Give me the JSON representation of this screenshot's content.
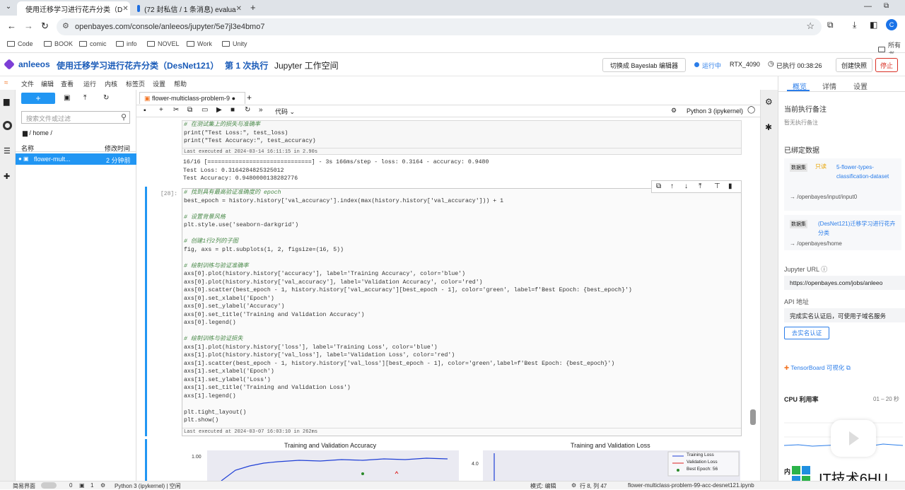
{
  "browser": {
    "tabs": [
      {
        "title": "使用迁移学习进行花卉分类（D"
      },
      {
        "title": "(72 封私信 / 1 条消息) evalua"
      }
    ],
    "url": "openbayes.com/console/anleeos/jupyter/5e7jl3e4bmo7",
    "profile_letter": "C",
    "bookmarks": [
      "Code",
      "BOOK",
      "comic",
      "info",
      "NOVEL",
      "Work",
      "Unity"
    ],
    "bookmarks_right": "所有书"
  },
  "header": {
    "user": "anleeos",
    "title": "使用迁移学习进行花卉分类（DesNet121）",
    "run": "第 1 次执行",
    "workspace": "Jupyter 工作空间",
    "switch_btn": "切换成 Bayeslab 编辑器",
    "status": "运行中",
    "gpu": "RTX_4090",
    "elapsed": "已执行 00:38:26",
    "snapshot_btn": "创建快照",
    "stop_btn": "停止"
  },
  "menu": [
    "文件",
    "编辑",
    "查看",
    "运行",
    "内核",
    "标签页",
    "设置",
    "帮助"
  ],
  "filebrowser": {
    "new_label": "+",
    "search_placeholder": "搜索文件或过滤",
    "path": "/ home /",
    "col_name": "名称",
    "col_modified": "修改时间",
    "files": [
      {
        "name": "flower-mult...",
        "modified": "2 分钟前"
      }
    ]
  },
  "notebook": {
    "tab_title": "flower-multiclass-problem-9",
    "cell_type": "代码",
    "kernel": "Python 3 (ipykernel)",
    "cell1": {
      "lines": [
        [
          "cm",
          "# 在测试集上的损失与准确率"
        ],
        [
          "",
          "print(\"Test Loss:\", test_loss)"
        ],
        [
          "",
          "print(\"Test Accuracy:\", test_accuracy)"
        ]
      ],
      "executed": "Last executed at 2024-03-14 16:11:15 in 2.90s",
      "output": [
        "16/16 [==============================] - 3s 166ms/step - loss: 0.3164 - accuracy: 0.9480",
        "Test Loss: 0.3164284825325012",
        "Test Accuracy: 0.9480000138282776"
      ]
    },
    "cell2": {
      "prompt": "[28]:",
      "lines": [
        [
          "cm",
          "# 找到具有最高验证准确度的 epoch"
        ],
        [
          "",
          "best_epoch = history.history['val_accuracy'].index(max(history.history['val_accuracy'])) + 1"
        ],
        [
          "",
          ""
        ],
        [
          "cm",
          "# 设置背景风格"
        ],
        [
          "",
          "plt.style.use('seaborn-darkgrid')"
        ],
        [
          "",
          ""
        ],
        [
          "cm",
          "# 创建1行2列的子图"
        ],
        [
          "",
          "fig, axs = plt.subplots(1, 2, figsize=(16, 5))"
        ],
        [
          "",
          ""
        ],
        [
          "cm",
          "# 绘制训练与验证准确率"
        ],
        [
          "",
          "axs[0].plot(history.history['accuracy'], label='Training Accuracy', color='blue')"
        ],
        [
          "",
          "axs[0].plot(history.history['val_accuracy'], label='Validation Accuracy', color='red')"
        ],
        [
          "",
          "axs[0].scatter(best_epoch - 1, history.history['val_accuracy'][best_epoch - 1], color='green', label=f'Best Epoch: {best_epoch}')"
        ],
        [
          "",
          "axs[0].set_xlabel('Epoch')"
        ],
        [
          "",
          "axs[0].set_ylabel('Accuracy')"
        ],
        [
          "",
          "axs[0].set_title('Training and Validation Accuracy')"
        ],
        [
          "",
          "axs[0].legend()"
        ],
        [
          "",
          ""
        ],
        [
          "cm",
          "# 绘制训练与验证损失"
        ],
        [
          "",
          "axs[1].plot(history.history['loss'], label='Training Loss', color='blue')"
        ],
        [
          "",
          "axs[1].plot(history.history['val_loss'], label='Validation Loss', color='red')"
        ],
        [
          "",
          "axs[1].scatter(best_epoch - 1, history.history['val_loss'][best_epoch - 1], color='green',label=f'Best Epoch: {best_epoch}')"
        ],
        [
          "",
          "axs[1].set_xlabel('Epoch')"
        ],
        [
          "",
          "axs[1].set_ylabel('Loss')"
        ],
        [
          "",
          "axs[1].set_title('Training and Validation Loss')"
        ],
        [
          "",
          "axs[1].legend()"
        ],
        [
          "",
          ""
        ],
        [
          "",
          "plt.tight_layout()"
        ],
        [
          "",
          "plt.show()"
        ]
      ],
      "executed": "Last executed at 2024-03-07 16:03:10 in 262ms"
    },
    "plot_left": {
      "title": "Training and Validation Accuracy",
      "ytick": "1.00"
    },
    "plot_right": {
      "title": "Training and Validation Loss",
      "ytick": "4.0",
      "legend": [
        "Training Loss",
        "Validation Loss",
        "Best Epoch: 56"
      ]
    }
  },
  "rightpanel": {
    "tabs": [
      "概览",
      "详情",
      "设置"
    ],
    "note_title": "当前执行备注",
    "note_value": "暂无执行备注",
    "bound_title": "已绑定数据",
    "dataset_badge": "数据集",
    "dataset_name": "5-flower-types-classification-dataset",
    "dataset_path": "→ /openbayes/input/input0",
    "dataset2_name": "(DesNet121)迁移学习进行花卉分类",
    "dataset2_path": "→ /openbayes/home",
    "jupyter_label": "Jupyter URL",
    "jupyter_url": "https://openbayes.com/jobs/anleeo",
    "api_label": "API 地址",
    "api_value": "完成实名认证后，可使用子域名服务",
    "verify_btn": "去实名认证",
    "tensorboard": "TensorBoard 可视化",
    "cpu_label": "CPU 利用率",
    "cpu_range": "01 – 20 秒",
    "mem_label": "内"
  },
  "statusbar": {
    "mode": "简易界面",
    "n0": "0",
    "n1": "1",
    "kernel": "Python 3 (ipykernel) | 空闲",
    "edit_mode": "模式: 编辑",
    "position": "行 8, 列 47",
    "file": "flower-multiclass-problem-99-acc-desnet121.ipynb"
  },
  "watermark": "IT技术6HU",
  "colors": {
    "accent": "#2b7de9",
    "header_title": "#1a5bb8",
    "stop": "#d93025",
    "jupyter_blue": "#2196f3"
  }
}
